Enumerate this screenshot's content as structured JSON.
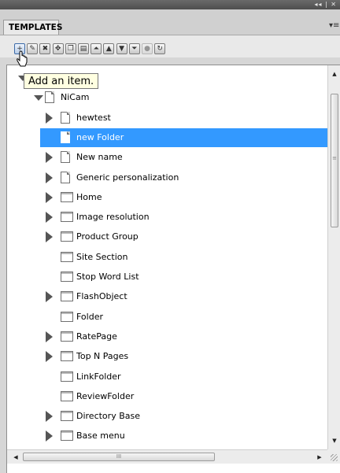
{
  "window": {
    "controls": "◂◂ | ✕"
  },
  "panel": {
    "tab_label": "TEMPLATES",
    "menu_icon": "panel-menu-icon"
  },
  "toolbar": {
    "buttons": [
      {
        "name": "add-item-button",
        "icon": "add-item-icon",
        "glyph": "+",
        "state": "active"
      },
      {
        "name": "edit-button",
        "icon": "edit-icon",
        "glyph": "✎",
        "state": "normal"
      },
      {
        "name": "delete-button",
        "icon": "delete-icon",
        "glyph": "✖",
        "state": "normal"
      },
      {
        "name": "move-button",
        "icon": "move-icon",
        "glyph": "✥",
        "state": "normal"
      },
      {
        "name": "copy-button",
        "icon": "copy-icon",
        "glyph": "❐",
        "state": "normal"
      },
      {
        "name": "paste-button",
        "icon": "paste-icon",
        "glyph": "▤",
        "state": "normal"
      },
      {
        "name": "move-to-top-button",
        "icon": "double-chevron-up-icon",
        "glyph": "⏶",
        "state": "normal"
      },
      {
        "name": "move-up-button",
        "icon": "chevron-up-icon",
        "glyph": "▲",
        "state": "normal"
      },
      {
        "name": "move-down-button",
        "icon": "chevron-down-icon",
        "glyph": "▼",
        "state": "normal"
      },
      {
        "name": "move-to-bottom-button",
        "icon": "double-chevron-down-icon",
        "glyph": "⏷",
        "state": "normal"
      },
      {
        "name": "disabled-action-button",
        "icon": "circle-icon",
        "glyph": "●",
        "state": "disabled"
      },
      {
        "name": "refresh-button",
        "icon": "refresh-icon",
        "glyph": "↻",
        "state": "normal"
      }
    ]
  },
  "tooltip": {
    "text": "Add an item."
  },
  "tree": {
    "items": [
      {
        "label": "NiCam",
        "icon": "document-icon",
        "expander": "expanded",
        "level": 1,
        "selected": false
      },
      {
        "label": "hewtest",
        "icon": "document-icon",
        "expander": "collapsed",
        "level": 2,
        "selected": false
      },
      {
        "label": "new Folder",
        "icon": "document-icon",
        "expander": "none",
        "level": 2,
        "selected": true
      },
      {
        "label": "New name",
        "icon": "document-icon",
        "expander": "collapsed",
        "level": 2,
        "selected": false
      },
      {
        "label": "Generic personalization",
        "icon": "document-icon",
        "expander": "collapsed",
        "level": 2,
        "selected": false
      },
      {
        "label": "Home",
        "icon": "template-icon",
        "expander": "collapsed",
        "level": 2,
        "selected": false
      },
      {
        "label": "Image resolution",
        "icon": "template-icon",
        "expander": "collapsed",
        "level": 2,
        "selected": false
      },
      {
        "label": "Product Group",
        "icon": "template-icon",
        "expander": "collapsed",
        "level": 2,
        "selected": false
      },
      {
        "label": "Site Section",
        "icon": "template-icon",
        "expander": "none",
        "level": 2,
        "selected": false
      },
      {
        "label": "Stop Word List",
        "icon": "template-icon",
        "expander": "none",
        "level": 2,
        "selected": false
      },
      {
        "label": "FlashObject",
        "icon": "template-icon",
        "expander": "collapsed",
        "level": 2,
        "selected": false
      },
      {
        "label": "Folder",
        "icon": "template-icon",
        "expander": "none",
        "level": 2,
        "selected": false
      },
      {
        "label": "RatePage",
        "icon": "template-icon",
        "expander": "collapsed",
        "level": 2,
        "selected": false
      },
      {
        "label": "Top N Pages",
        "icon": "template-icon",
        "expander": "collapsed",
        "level": 2,
        "selected": false
      },
      {
        "label": "LinkFolder",
        "icon": "template-icon",
        "expander": "none",
        "level": 2,
        "selected": false
      },
      {
        "label": "ReviewFolder",
        "icon": "template-icon",
        "expander": "none",
        "level": 2,
        "selected": false
      },
      {
        "label": "Directory Base",
        "icon": "template-icon",
        "expander": "collapsed",
        "level": 2,
        "selected": false
      },
      {
        "label": "Base menu",
        "icon": "template-icon",
        "expander": "collapsed",
        "level": 2,
        "selected": false
      }
    ]
  },
  "scrollbars": {
    "h_thumb_grip": "III",
    "v_thumb_grip": "≡"
  },
  "colors": {
    "selection": "#3399ff",
    "tooltip_bg": "#ffffe1"
  }
}
